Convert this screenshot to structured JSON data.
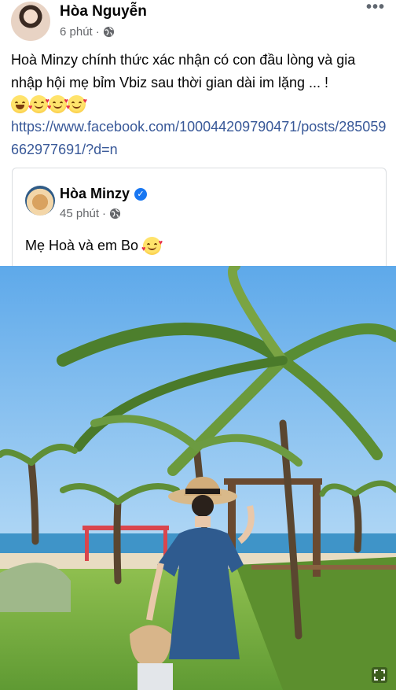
{
  "post": {
    "author": "Hòa Nguyễn",
    "time": "6 phút",
    "separator": "·",
    "privacy_icon": "globe-icon",
    "more_icon": "more-icon",
    "text": "Hoà Minzy chính thức xác nhận có con đầu lòng và gia nhập hội mẹ bỉm Vbiz sau thời gian dài im lặng ... !",
    "emojis": [
      "grinning-face",
      "smiling-face-with-hearts",
      "smiling-face-with-hearts",
      "smiling-face-with-hearts"
    ],
    "link": "https://www.facebook.com/100044209790471/posts/285059662977691/?d=n"
  },
  "shared_post": {
    "author": "Hòa Minzy",
    "verified_icon": "verified-badge-icon",
    "time": "45 phút",
    "separator": "·",
    "privacy_icon": "globe-icon",
    "text": "Mẹ Hoà và em Bo",
    "emoji": "smiling-face-with-hearts"
  },
  "photo": {
    "icon": "expand-icon"
  },
  "colors": {
    "link": "#385898",
    "meta": "#65676b",
    "verified": "#1877f2",
    "border": "#dadde1"
  }
}
